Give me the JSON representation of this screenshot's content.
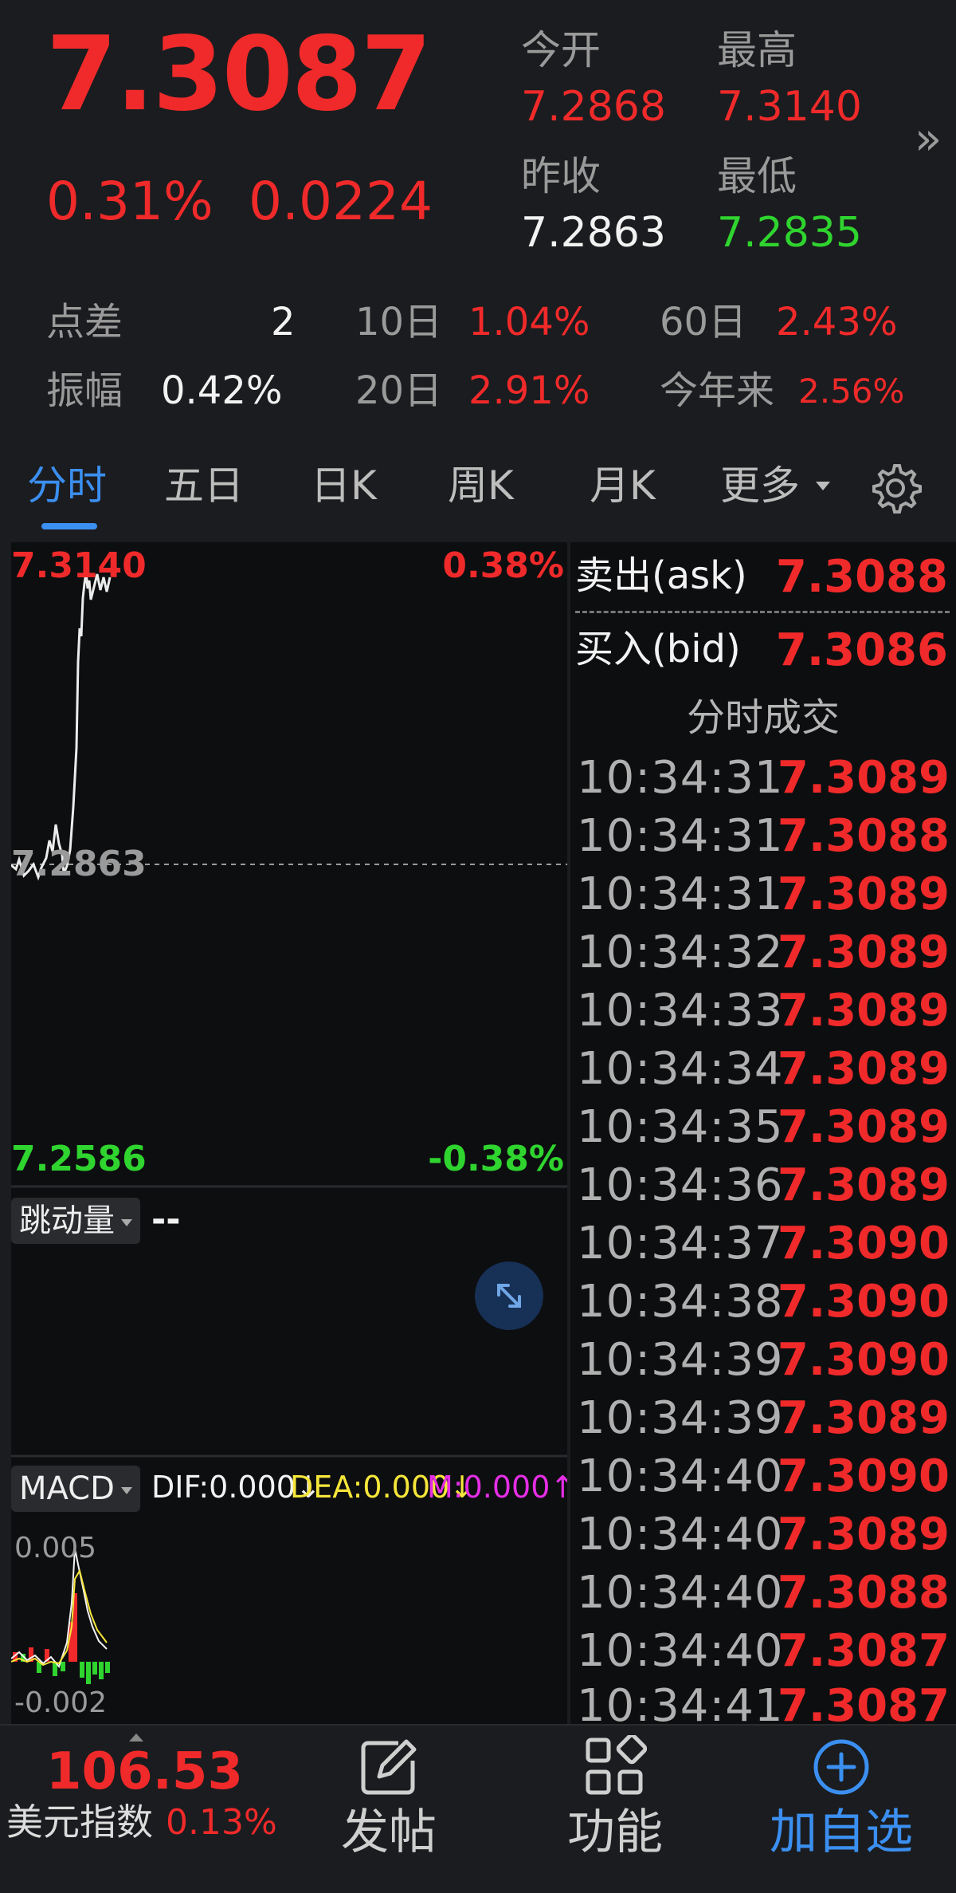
{
  "quote": {
    "price": "7.3087",
    "change_pct": "0.31%",
    "change_abs": "0.0224",
    "open_label": "今开",
    "open_value": "7.2868",
    "high_label": "最高",
    "high_value": "7.3140",
    "prev_close_label": "昨收",
    "prev_close_value": "7.2863",
    "low_label": "最低",
    "low_value": "7.2835"
  },
  "stats": {
    "spread_label": "点差",
    "spread_value": "2",
    "amplitude_label": "振幅",
    "amplitude_value": "0.42%",
    "d10_label": "10日",
    "d10_value": "1.04%",
    "d20_label": "20日",
    "d20_value": "2.91%",
    "d60_label": "60日",
    "d60_value": "2.43%",
    "ytd_label": "今年来",
    "ytd_value": "2.56%"
  },
  "tabs": [
    "分时",
    "五日",
    "日K",
    "周K",
    "月K",
    "更多"
  ],
  "chart": {
    "top_price": "7.3140",
    "top_pct": "0.38%",
    "mid_price": "7.2863",
    "bottom_price": "7.2586",
    "bottom_pct": "-0.38%",
    "volume_indicator": "跳动量",
    "volume_value": "--",
    "macd_indicator": "MACD",
    "dif": "DIF:0.000↓",
    "dea": "DEA:0.000↓",
    "m": "M:0.000↑",
    "macd_top": "0.005",
    "macd_bottom": "-0.002",
    "colors": {
      "up": "#f02a2a",
      "down": "#2fd42f",
      "dif": "#ffffff",
      "dea": "#f5e63a",
      "m": "#e52ee5"
    }
  },
  "order_book": {
    "ask_label": "卖出(ask)",
    "ask_value": "7.3088",
    "bid_label": "买入(bid)",
    "bid_value": "7.3086",
    "ticks_title": "分时成交",
    "ticks": [
      {
        "time": "10:34:31",
        "price": "7.3089"
      },
      {
        "time": "10:34:31",
        "price": "7.3088"
      },
      {
        "time": "10:34:31",
        "price": "7.3089"
      },
      {
        "time": "10:34:32",
        "price": "7.3089"
      },
      {
        "time": "10:34:33",
        "price": "7.3089"
      },
      {
        "time": "10:34:34",
        "price": "7.3089"
      },
      {
        "time": "10:34:35",
        "price": "7.3089"
      },
      {
        "time": "10:34:36",
        "price": "7.3089"
      },
      {
        "time": "10:34:37",
        "price": "7.3090"
      },
      {
        "time": "10:34:38",
        "price": "7.3090"
      },
      {
        "time": "10:34:39",
        "price": "7.3090"
      },
      {
        "time": "10:34:39",
        "price": "7.3089"
      },
      {
        "time": "10:34:40",
        "price": "7.3090"
      },
      {
        "time": "10:34:40",
        "price": "7.3089"
      },
      {
        "time": "10:34:40",
        "price": "7.3088"
      },
      {
        "time": "10:34:40",
        "price": "7.3087"
      },
      {
        "time": "10:34:41",
        "price": "7.3087"
      }
    ]
  },
  "bottom_nav": {
    "index_value": "106.53",
    "index_name": "美元指数",
    "index_pct": "0.13%",
    "post_label": "发帖",
    "functions_label": "功能",
    "add_watch_label": "加自选"
  }
}
